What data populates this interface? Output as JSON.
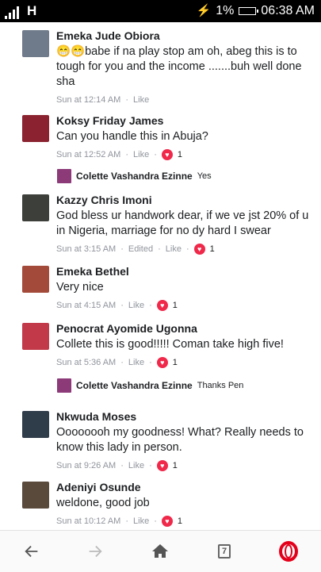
{
  "status_bar": {
    "carrier_glyph": "H",
    "battery": "1%",
    "time": "06:38 AM"
  },
  "comments": [
    {
      "name": "Emeka Jude Obiora",
      "emoji": "😁😁",
      "text": "babe if na play stop am oh, abeg this is to tough for you and the income .......buh well done sha",
      "time": "Sun at 12:14 AM",
      "like": "Like",
      "avatar_color": "#6f7a8a"
    },
    {
      "name": "Koksy Friday James",
      "text": "Can you handle this in Abuja?",
      "time": "Sun at 12:52 AM",
      "like": "Like",
      "reactions": "1",
      "avatar_color": "#8a2230"
    },
    {
      "name": "Kazzy Chris Imoni",
      "text": "God bless ur handwork dear, if we ve jst 20% of u in Nigeria, marriage for no dy hard I swear",
      "time": "Sun at 3:15 AM",
      "edited": "Edited",
      "like": "Like",
      "reactions": "1",
      "avatar_color": "#3c3f3a"
    },
    {
      "name": "Emeka Bethel",
      "text": "Very nice",
      "time": "Sun at 4:15 AM",
      "like": "Like",
      "reactions": "1",
      "avatar_color": "#a44a3a"
    },
    {
      "name": "Penocrat Ayomide Ugonna",
      "text": "Collete this is good!!!!! Coman take high five!",
      "time": "Sun at 5:36 AM",
      "like": "Like",
      "reactions": "1",
      "avatar_color": "#c23a4a"
    },
    {
      "name": "Nkwuda Moses",
      "text": "Oooooooh my goodness! What?  Really needs to know this lady in person.",
      "time": "Sun at 9:26 AM",
      "like": "Like",
      "reactions": "1",
      "avatar_color": "#2f3c4a"
    },
    {
      "name": "Adeniyi Osunde",
      "text": "weldone, good job",
      "time": "Sun at 10:12 AM",
      "like": "Like",
      "reactions": "1",
      "avatar_color": "#5a4a3c"
    }
  ],
  "replies": [
    {
      "name": "Colette Vashandra Ezinne",
      "text": "Yes",
      "avatar_color": "#8c3a78"
    },
    {
      "name": "Colette Vashandra Ezinne",
      "text": "Thanks Pen",
      "avatar_color": "#8c3a78"
    }
  ],
  "navbar": {
    "tabs_count": "7",
    "brand_color": "#e4001b"
  }
}
